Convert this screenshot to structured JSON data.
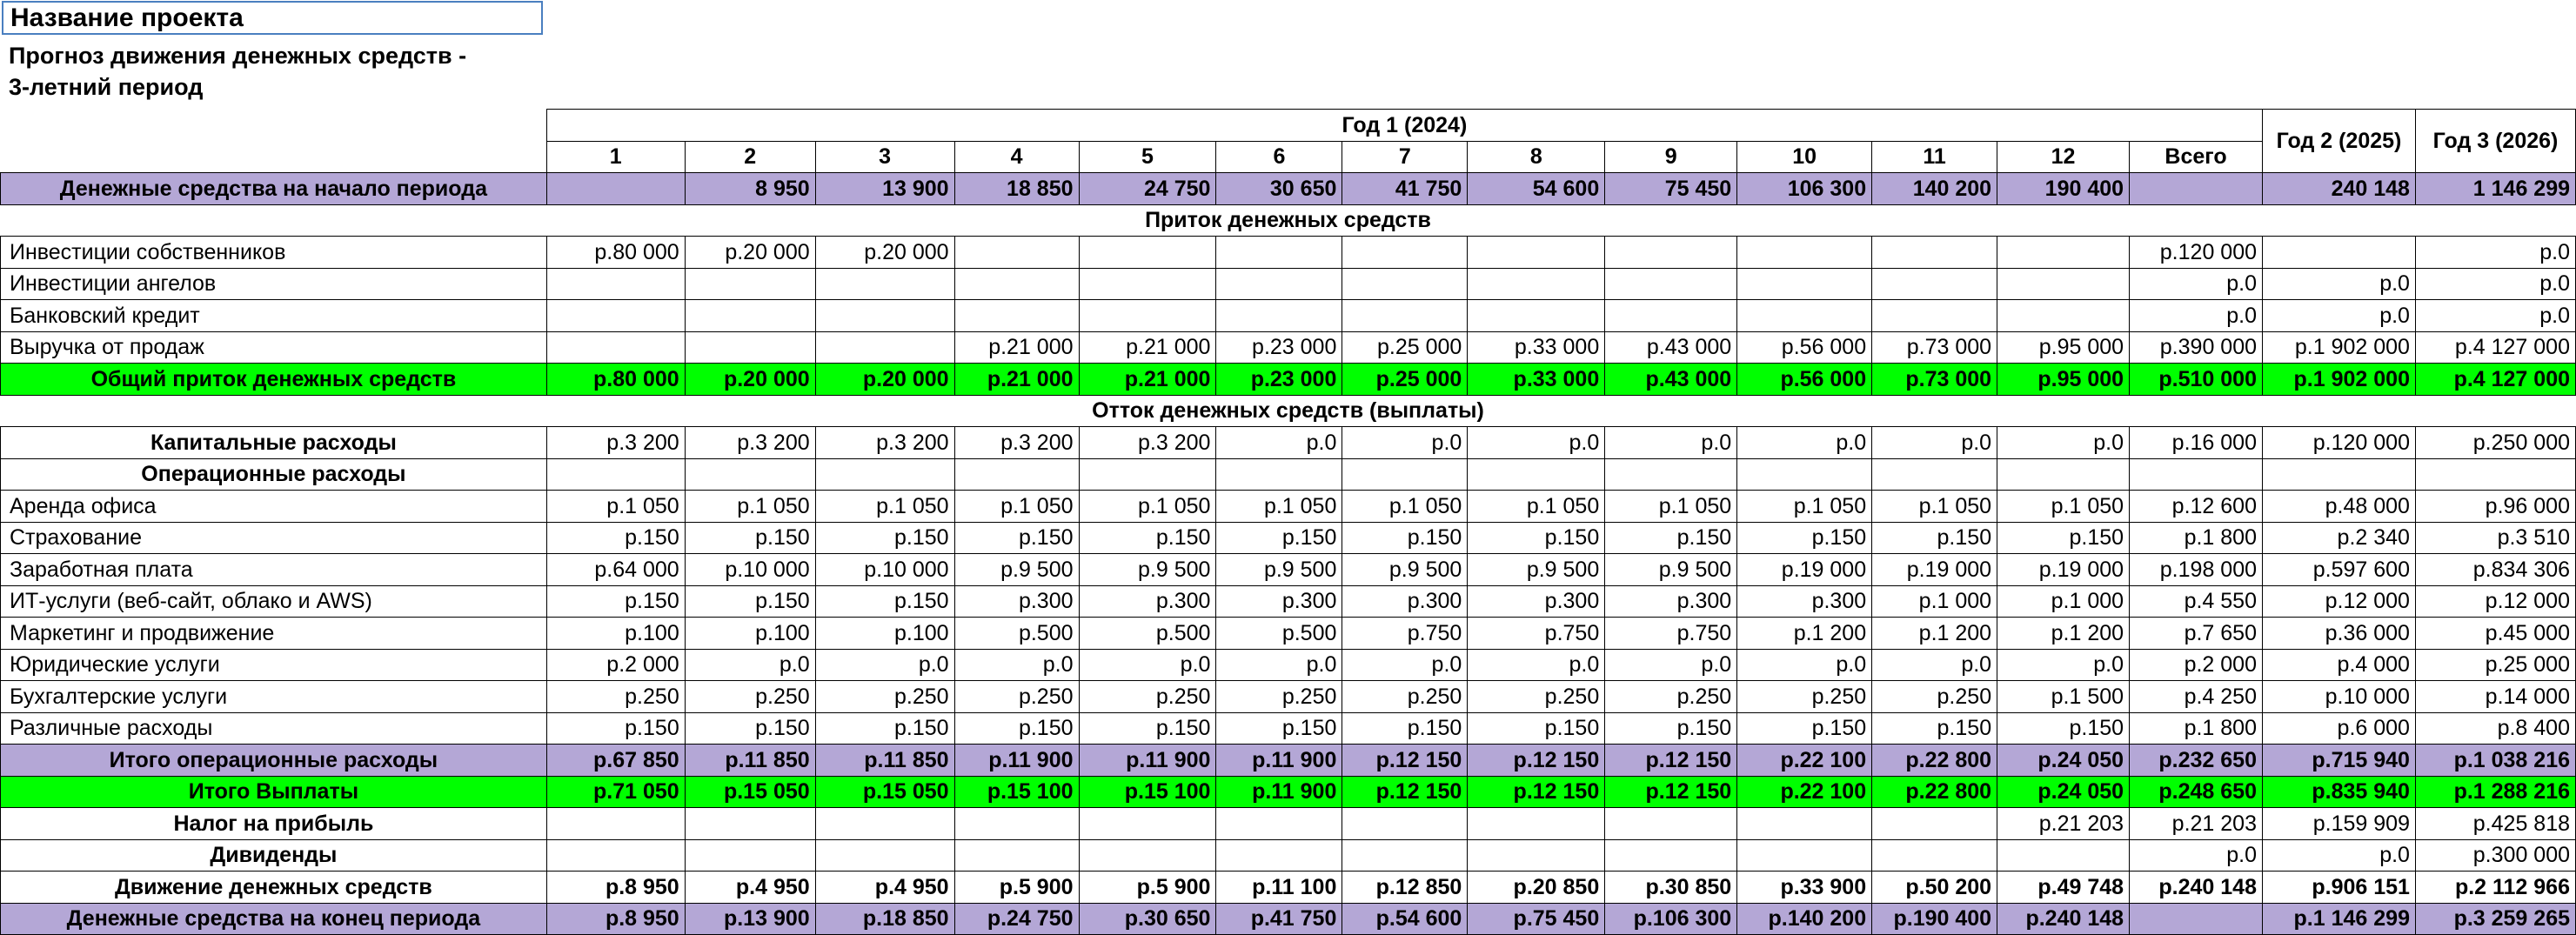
{
  "project_title": "Название проекта",
  "subtitle_line1": "Прогноз движения денежных средств -",
  "subtitle_line2": "3-летний период",
  "header": {
    "year1": "Год 1 (2024)",
    "months": [
      "1",
      "2",
      "3",
      "4",
      "5",
      "6",
      "7",
      "8",
      "9",
      "10",
      "11",
      "12"
    ],
    "total": "Всего",
    "year2": "Год 2 (2025)",
    "year3": "Год 3 (2026)"
  },
  "sections": {
    "inflow": "Приток денежных средств",
    "outflow": "Отток денежных средств (выплаты)"
  },
  "rows": {
    "opening": {
      "label": "Денежные средства на начало периода",
      "values": [
        "",
        "8 950",
        "13 900",
        "18 850",
        "24 750",
        "30 650",
        "41 750",
        "54 600",
        "75 450",
        "106 300",
        "140 200",
        "190 400",
        "",
        "240 148",
        "1 146 299"
      ]
    },
    "owners": {
      "label": "Инвестиции собственников",
      "values": [
        "р.80 000",
        "р.20 000",
        "р.20 000",
        "",
        "",
        "",
        "",
        "",
        "",
        "",
        "",
        "",
        "р.120 000",
        "",
        "р.0"
      ]
    },
    "angels": {
      "label": "Инвестиции ангелов",
      "values": [
        "",
        "",
        "",
        "",
        "",
        "",
        "",
        "",
        "",
        "",
        "",
        "",
        "р.0",
        "р.0",
        "р.0"
      ]
    },
    "loan": {
      "label": "Банковский кредит",
      "values": [
        "",
        "",
        "",
        "",
        "",
        "",
        "",
        "",
        "",
        "",
        "",
        "",
        "р.0",
        "р.0",
        "р.0"
      ]
    },
    "sales": {
      "label": "Выручка от продаж",
      "values": [
        "",
        "",
        "",
        "р.21 000",
        "р.21 000",
        "р.23 000",
        "р.25 000",
        "р.33 000",
        "р.43 000",
        "р.56 000",
        "р.73 000",
        "р.95 000",
        "р.390 000",
        "р.1 902 000",
        "р.4 127 000"
      ]
    },
    "total_inflow": {
      "label": "Общий приток денежных средств",
      "values": [
        "р.80 000",
        "р.20 000",
        "р.20 000",
        "р.21 000",
        "р.21 000",
        "р.23 000",
        "р.25 000",
        "р.33 000",
        "р.43 000",
        "р.56 000",
        "р.73 000",
        "р.95 000",
        "р.510 000",
        "р.1 902 000",
        "р.4 127 000"
      ]
    },
    "capex": {
      "label": "Капитальные расходы",
      "values": [
        "р.3 200",
        "р.3 200",
        "р.3 200",
        "р.3 200",
        "р.3 200",
        "р.0",
        "р.0",
        "р.0",
        "р.0",
        "р.0",
        "р.0",
        "р.0",
        "р.16 000",
        "р.120 000",
        "р.250 000"
      ]
    },
    "opex_header": {
      "label": "Операционные расходы"
    },
    "rent": {
      "label": "Аренда офиса",
      "values": [
        "р.1 050",
        "р.1 050",
        "р.1 050",
        "р.1 050",
        "р.1 050",
        "р.1 050",
        "р.1 050",
        "р.1 050",
        "р.1 050",
        "р.1 050",
        "р.1 050",
        "р.1 050",
        "р.12 600",
        "р.48 000",
        "р.96 000"
      ]
    },
    "insurance": {
      "label": "Страхование",
      "values": [
        "р.150",
        "р.150",
        "р.150",
        "р.150",
        "р.150",
        "р.150",
        "р.150",
        "р.150",
        "р.150",
        "р.150",
        "р.150",
        "р.150",
        "р.1 800",
        "р.2 340",
        "р.3 510"
      ]
    },
    "salary": {
      "label": "Заработная плата",
      "values": [
        "р.64 000",
        "р.10 000",
        "р.10 000",
        "р.9 500",
        "р.9 500",
        "р.9 500",
        "р.9 500",
        "р.9 500",
        "р.9 500",
        "р.19 000",
        "р.19 000",
        "р.19 000",
        "р.198 000",
        "р.597 600",
        "р.834 306"
      ]
    },
    "it": {
      "label": "ИТ-услуги (веб-сайт, облако и AWS)",
      "values": [
        "р.150",
        "р.150",
        "р.150",
        "р.300",
        "р.300",
        "р.300",
        "р.300",
        "р.300",
        "р.300",
        "р.300",
        "р.1 000",
        "р.1 000",
        "р.4 550",
        "р.12 000",
        "р.12 000"
      ]
    },
    "marketing": {
      "label": "Маркетинг и продвижение",
      "values": [
        "р.100",
        "р.100",
        "р.100",
        "р.500",
        "р.500",
        "р.500",
        "р.750",
        "р.750",
        "р.750",
        "р.1 200",
        "р.1 200",
        "р.1 200",
        "р.7 650",
        "р.36 000",
        "р.45 000"
      ]
    },
    "legal": {
      "label": "Юридические услуги",
      "values": [
        "р.2 000",
        "р.0",
        "р.0",
        "р.0",
        "р.0",
        "р.0",
        "р.0",
        "р.0",
        "р.0",
        "р.0",
        "р.0",
        "р.0",
        "р.2 000",
        "р.4 000",
        "р.25 000"
      ]
    },
    "accounting": {
      "label": "Бухгалтерские услуги",
      "values": [
        "р.250",
        "р.250",
        "р.250",
        "р.250",
        "р.250",
        "р.250",
        "р.250",
        "р.250",
        "р.250",
        "р.250",
        "р.250",
        "р.1 500",
        "р.4 250",
        "р.10 000",
        "р.14 000"
      ]
    },
    "misc": {
      "label": "Различные расходы",
      "values": [
        "р.150",
        "р.150",
        "р.150",
        "р.150",
        "р.150",
        "р.150",
        "р.150",
        "р.150",
        "р.150",
        "р.150",
        "р.150",
        "р.150",
        "р.1 800",
        "р.6 000",
        "р.8 400"
      ]
    },
    "total_opex": {
      "label": "Итого операционные расходы",
      "values": [
        "р.67 850",
        "р.11 850",
        "р.11 850",
        "р.11 900",
        "р.11 900",
        "р.11 900",
        "р.12 150",
        "р.12 150",
        "р.12 150",
        "р.22 100",
        "р.22 800",
        "р.24 050",
        "р.232 650",
        "р.715 940",
        "р.1 038 216"
      ]
    },
    "total_payments": {
      "label": "Итого Выплаты",
      "values": [
        "р.71 050",
        "р.15 050",
        "р.15 050",
        "р.15 100",
        "р.15 100",
        "р.11 900",
        "р.12 150",
        "р.12 150",
        "р.12 150",
        "р.22 100",
        "р.22 800",
        "р.24 050",
        "р.248 650",
        "р.835 940",
        "р.1 288 216"
      ]
    },
    "tax": {
      "label": "Налог на прибыль",
      "values": [
        "",
        "",
        "",
        "",
        "",
        "",
        "",
        "",
        "",
        "",
        "",
        "р.21 203",
        "р.21 203",
        "р.159 909",
        "р.425 818"
      ]
    },
    "dividends": {
      "label": "Дивиденды",
      "values": [
        "",
        "",
        "",
        "",
        "",
        "",
        "",
        "",
        "",
        "",
        "",
        "",
        "р.0",
        "р.0",
        "р.300 000"
      ]
    },
    "net_flow": {
      "label": "Движение денежных средств",
      "values": [
        "р.8 950",
        "р.4 950",
        "р.4 950",
        "р.5 900",
        "р.5 900",
        "р.11 100",
        "р.12 850",
        "р.20 850",
        "р.30 850",
        "р.33 900",
        "р.50 200",
        "р.49 748",
        "р.240 148",
        "р.906 151",
        "р.2 112 966"
      ]
    },
    "closing": {
      "label": "Денежные средства на конец периода",
      "values": [
        "р.8 950",
        "р.13 900",
        "р.18 850",
        "р.24 750",
        "р.30 650",
        "р.41 750",
        "р.54 600",
        "р.75 450",
        "р.106 300",
        "р.140 200",
        "р.190 400",
        "р.240 148",
        "",
        "р.1 146 299",
        "р.3 259 265"
      ]
    }
  },
  "colors": {
    "purple_row": "#b4a7d6",
    "green_row": "#00ff00",
    "title_border": "#4a7fc0"
  }
}
